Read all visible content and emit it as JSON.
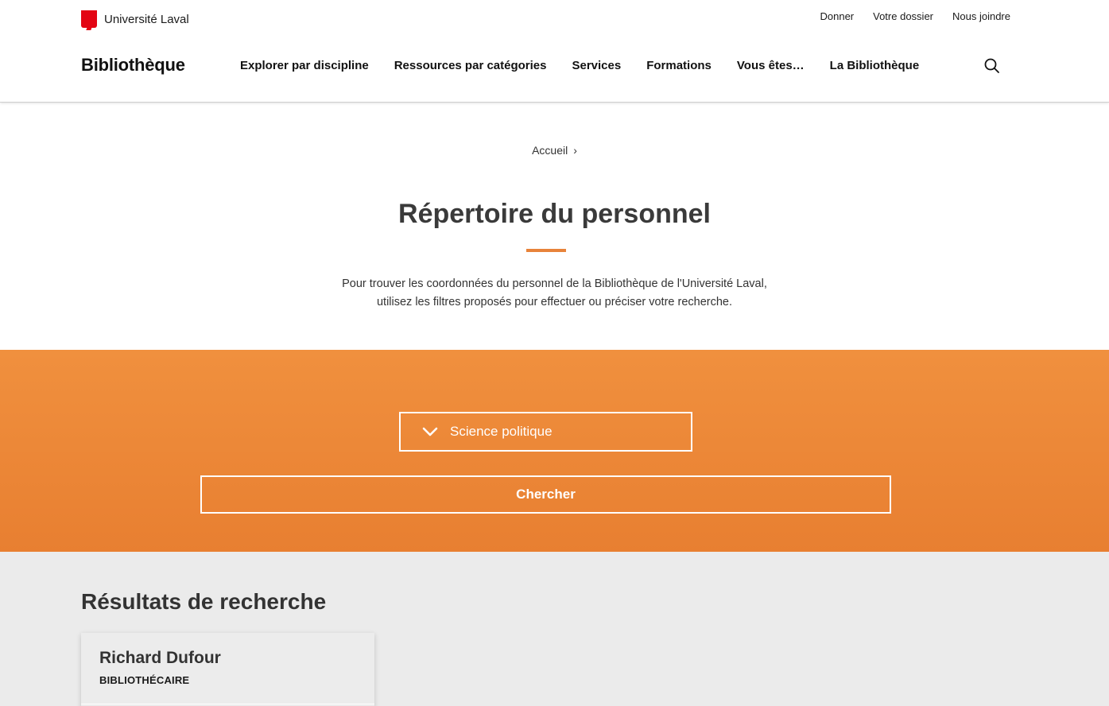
{
  "header": {
    "university": "Université Laval",
    "top_links": [
      "Donner",
      "Votre dossier",
      "Nous joindre"
    ],
    "site_title": "Bibliothèque",
    "nav": [
      "Explorer par discipline",
      "Ressources par catégories",
      "Services",
      "Formations",
      "Vous êtes…",
      "La Bibliothèque"
    ],
    "search_icon": "search-icon"
  },
  "breadcrumb": {
    "home": "Accueil",
    "separator": "›"
  },
  "page": {
    "title": "Répertoire du personnel",
    "intro_line1": "Pour trouver les coordonnées du personnel de la Bibliothèque de l'Université Laval,",
    "intro_line2": "utilisez les filtres proposés pour effectuer ou préciser votre recherche."
  },
  "search": {
    "selected_discipline": "Science politique",
    "dropdown_icon": "chevron-down-icon",
    "submit_label": "Chercher"
  },
  "results": {
    "title": "Résultats de recherche",
    "items": [
      {
        "name": "Richard Dufour",
        "role": "BIBLIOTHÉCAIRE"
      }
    ]
  },
  "colors": {
    "brand_red": "#e30513",
    "accent_orange": "#e8833a",
    "band_orange": "#ef8d3c",
    "results_bg": "#ebebeb"
  }
}
